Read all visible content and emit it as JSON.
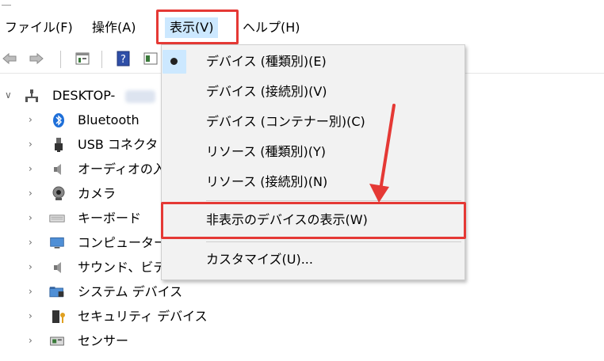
{
  "menubar": {
    "file": "ファイル(F)",
    "action": "操作(A)",
    "view": "表示(V)",
    "help": "ヘルプ(H)"
  },
  "tree": {
    "root": "DESKTOP-",
    "items": [
      {
        "label": "Bluetooth"
      },
      {
        "label": "USB コネクタ"
      },
      {
        "label": "オーディオの入"
      },
      {
        "label": "カメラ"
      },
      {
        "label": "キーボード"
      },
      {
        "label": "コンピューター"
      },
      {
        "label": "サウンド、ビデ"
      },
      {
        "label": "システム デバイス"
      },
      {
        "label": "セキュリティ デバイス"
      },
      {
        "label": "センサー"
      }
    ]
  },
  "dropdown": {
    "items": [
      {
        "label": "デバイス (種類別)(E)",
        "checked": true
      },
      {
        "label": "デバイス (接続別)(V)"
      },
      {
        "label": "デバイス (コンテナー別)(C)"
      },
      {
        "label": "リソース (種類別)(Y)"
      },
      {
        "label": "リソース (接続別)(N)"
      },
      {
        "label": "非表示のデバイスの表示(W)"
      },
      {
        "label": "カスタマイズ(U)..."
      }
    ]
  },
  "colors": {
    "highlight_red": "#e53935",
    "selection_blue": "#cce8ff",
    "menu_bg": "#f2f2f2"
  }
}
